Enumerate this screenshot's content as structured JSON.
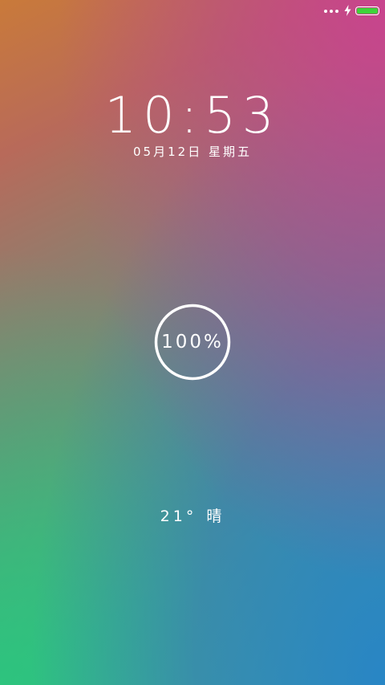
{
  "status_bar": {
    "more_icon": "three-dots-icon",
    "charging_icon": "lightning-icon",
    "battery_icon": "battery-icon",
    "battery_color": "#3fd23a",
    "battery_level": 1.0
  },
  "clock": {
    "time": "10:53",
    "date": "05月12日 星期五"
  },
  "charge": {
    "label": "100%",
    "progress": 1.0
  },
  "weather": {
    "temperature": "21°",
    "condition": "晴"
  }
}
